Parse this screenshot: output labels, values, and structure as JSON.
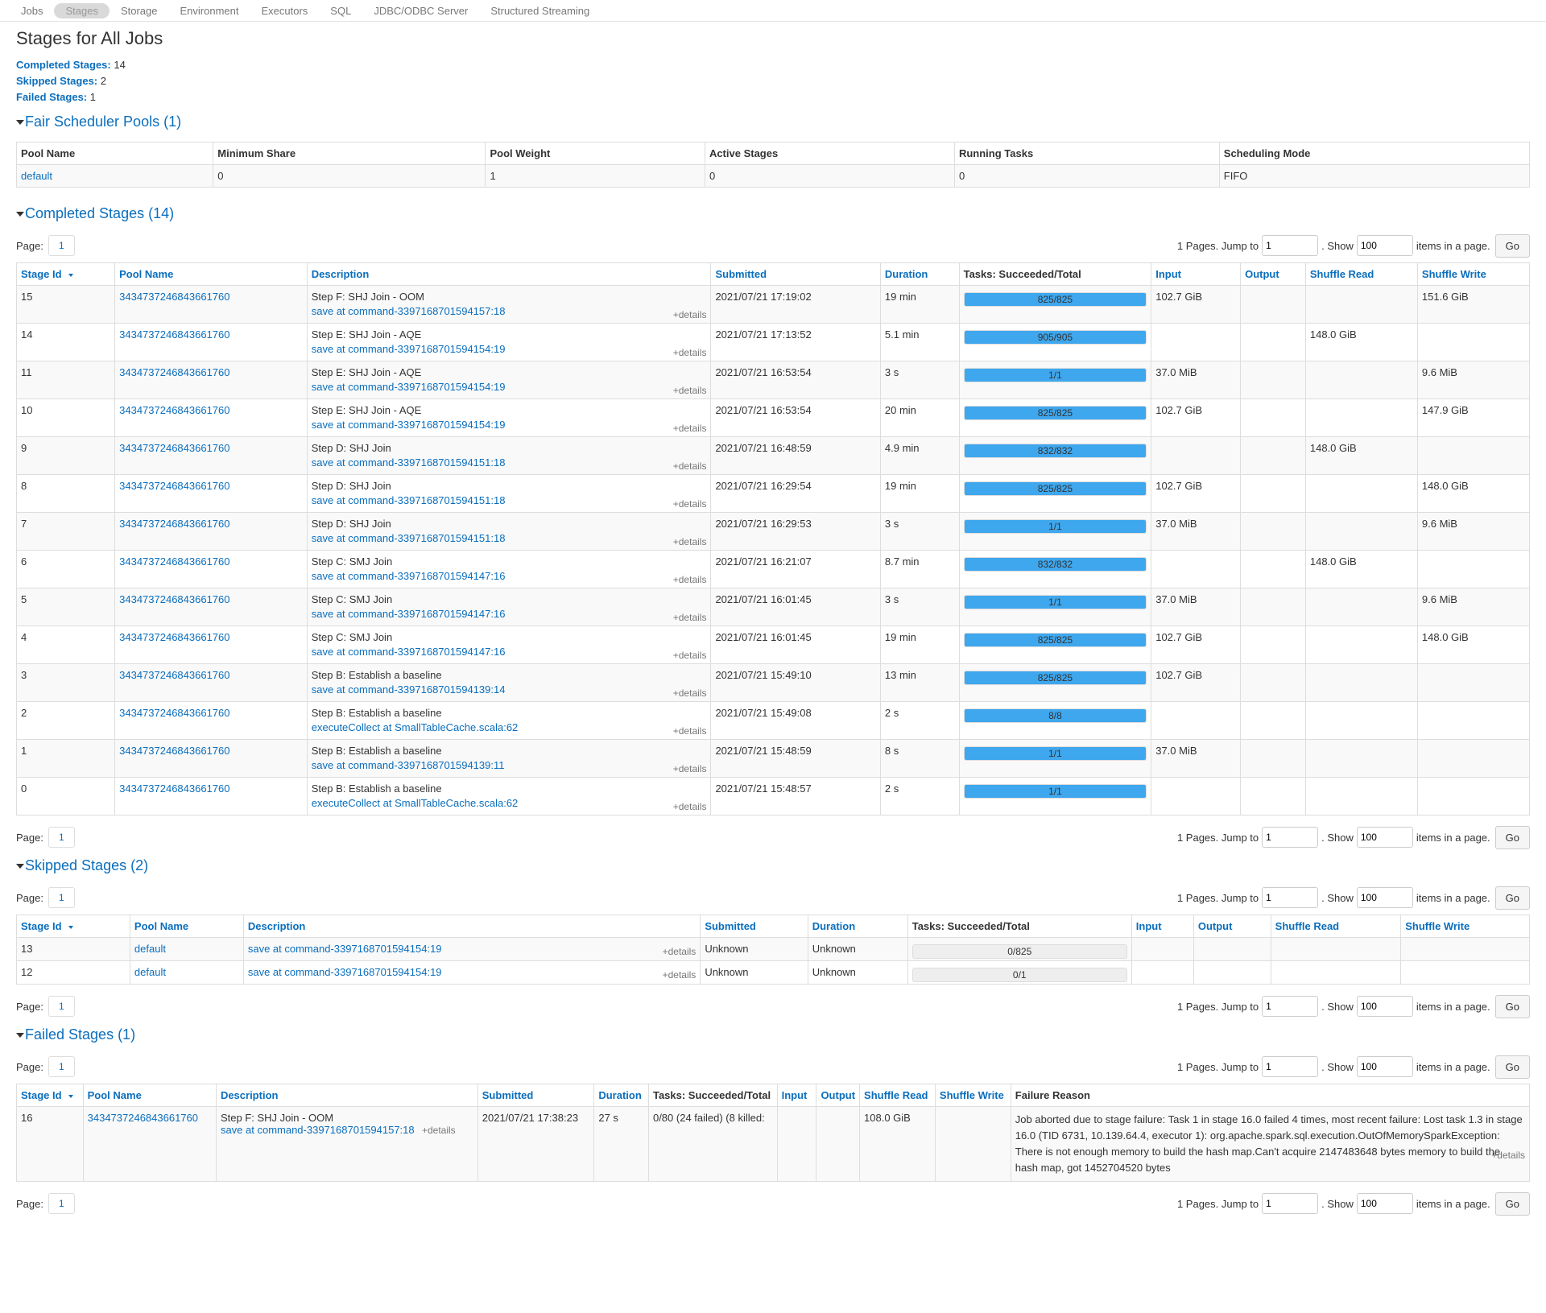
{
  "nav": {
    "tabs": [
      "Jobs",
      "Stages",
      "Storage",
      "Environment",
      "Executors",
      "SQL",
      "JDBC/ODBC Server",
      "Structured Streaming"
    ],
    "active": "Stages"
  },
  "page": {
    "title": "Stages for All Jobs",
    "summary": [
      {
        "label": "Completed Stages:",
        "value": "14"
      },
      {
        "label": "Skipped Stages:",
        "value": "2"
      },
      {
        "label": "Failed Stages:",
        "value": "1"
      }
    ]
  },
  "pools": {
    "header": "Fair Scheduler Pools (1)",
    "columns": [
      "Pool Name",
      "Minimum Share",
      "Pool Weight",
      "Active Stages",
      "Running Tasks",
      "Scheduling Mode"
    ],
    "rows": [
      [
        "default",
        "0",
        "1",
        "0",
        "0",
        "FIFO"
      ]
    ]
  },
  "pager": {
    "page_label": "Page:",
    "page": "1",
    "pages_text": "1 Pages. Jump to",
    "jump_value": "1",
    "show_label": ". Show",
    "show_value": "100",
    "items_label": "items in a page.",
    "go": "Go"
  },
  "details_label": "+details",
  "completed": {
    "header": "Completed Stages (14)",
    "columns": [
      "Stage Id",
      "Pool Name",
      "Description",
      "Submitted",
      "Duration",
      "Tasks: Succeeded/Total",
      "Input",
      "Output",
      "Shuffle Read",
      "Shuffle Write"
    ],
    "rows": [
      {
        "id": "15",
        "pool": "3434737246843661760",
        "desc": "Step F: SHJ Join - OOM",
        "link": "save at command-3397168701594157:18",
        "submitted": "2021/07/21 17:19:02",
        "duration": "19 min",
        "tasks": "825/825",
        "progress": 1,
        "input": "102.7 GiB",
        "output": "",
        "sread": "",
        "swrite": "151.6 GiB"
      },
      {
        "id": "14",
        "pool": "3434737246843661760",
        "desc": "Step E: SHJ Join - AQE",
        "link": "save at command-3397168701594154:19",
        "submitted": "2021/07/21 17:13:52",
        "duration": "5.1 min",
        "tasks": "905/905",
        "progress": 1,
        "input": "",
        "output": "",
        "sread": "148.0 GiB",
        "swrite": ""
      },
      {
        "id": "11",
        "pool": "3434737246843661760",
        "desc": "Step E: SHJ Join - AQE",
        "link": "save at command-3397168701594154:19",
        "submitted": "2021/07/21 16:53:54",
        "duration": "3 s",
        "tasks": "1/1",
        "progress": 1,
        "input": "37.0 MiB",
        "output": "",
        "sread": "",
        "swrite": "9.6 MiB"
      },
      {
        "id": "10",
        "pool": "3434737246843661760",
        "desc": "Step E: SHJ Join - AQE",
        "link": "save at command-3397168701594154:19",
        "submitted": "2021/07/21 16:53:54",
        "duration": "20 min",
        "tasks": "825/825",
        "progress": 1,
        "input": "102.7 GiB",
        "output": "",
        "sread": "",
        "swrite": "147.9 GiB"
      },
      {
        "id": "9",
        "pool": "3434737246843661760",
        "desc": "Step D: SHJ Join",
        "link": "save at command-3397168701594151:18",
        "submitted": "2021/07/21 16:48:59",
        "duration": "4.9 min",
        "tasks": "832/832",
        "progress": 1,
        "input": "",
        "output": "",
        "sread": "148.0 GiB",
        "swrite": ""
      },
      {
        "id": "8",
        "pool": "3434737246843661760",
        "desc": "Step D: SHJ Join",
        "link": "save at command-3397168701594151:18",
        "submitted": "2021/07/21 16:29:54",
        "duration": "19 min",
        "tasks": "825/825",
        "progress": 1,
        "input": "102.7 GiB",
        "output": "",
        "sread": "",
        "swrite": "148.0 GiB"
      },
      {
        "id": "7",
        "pool": "3434737246843661760",
        "desc": "Step D: SHJ Join",
        "link": "save at command-3397168701594151:18",
        "submitted": "2021/07/21 16:29:53",
        "duration": "3 s",
        "tasks": "1/1",
        "progress": 1,
        "input": "37.0 MiB",
        "output": "",
        "sread": "",
        "swrite": "9.6 MiB"
      },
      {
        "id": "6",
        "pool": "3434737246843661760",
        "desc": "Step C: SMJ Join",
        "link": "save at command-3397168701594147:16",
        "submitted": "2021/07/21 16:21:07",
        "duration": "8.7 min",
        "tasks": "832/832",
        "progress": 1,
        "input": "",
        "output": "",
        "sread": "148.0 GiB",
        "swrite": ""
      },
      {
        "id": "5",
        "pool": "3434737246843661760",
        "desc": "Step C: SMJ Join",
        "link": "save at command-3397168701594147:16",
        "submitted": "2021/07/21 16:01:45",
        "duration": "3 s",
        "tasks": "1/1",
        "progress": 1,
        "input": "37.0 MiB",
        "output": "",
        "sread": "",
        "swrite": "9.6 MiB"
      },
      {
        "id": "4",
        "pool": "3434737246843661760",
        "desc": "Step C: SMJ Join",
        "link": "save at command-3397168701594147:16",
        "submitted": "2021/07/21 16:01:45",
        "duration": "19 min",
        "tasks": "825/825",
        "progress": 1,
        "input": "102.7 GiB",
        "output": "",
        "sread": "",
        "swrite": "148.0 GiB"
      },
      {
        "id": "3",
        "pool": "3434737246843661760",
        "desc": "Step B: Establish a baseline",
        "link": "save at command-3397168701594139:14",
        "submitted": "2021/07/21 15:49:10",
        "duration": "13 min",
        "tasks": "825/825",
        "progress": 1,
        "input": "102.7 GiB",
        "output": "",
        "sread": "",
        "swrite": ""
      },
      {
        "id": "2",
        "pool": "3434737246843661760",
        "desc": "Step B: Establish a baseline",
        "link": "executeCollect at SmallTableCache.scala:62",
        "submitted": "2021/07/21 15:49:08",
        "duration": "2 s",
        "tasks": "8/8",
        "progress": 1,
        "input": "",
        "output": "",
        "sread": "",
        "swrite": ""
      },
      {
        "id": "1",
        "pool": "3434737246843661760",
        "desc": "Step B: Establish a baseline",
        "link": "save at command-3397168701594139:11",
        "submitted": "2021/07/21 15:48:59",
        "duration": "8 s",
        "tasks": "1/1",
        "progress": 1,
        "input": "37.0 MiB",
        "output": "",
        "sread": "",
        "swrite": ""
      },
      {
        "id": "0",
        "pool": "3434737246843661760",
        "desc": "Step B: Establish a baseline",
        "link": "executeCollect at SmallTableCache.scala:62",
        "submitted": "2021/07/21 15:48:57",
        "duration": "2 s",
        "tasks": "1/1",
        "progress": 1,
        "input": "",
        "output": "",
        "sread": "",
        "swrite": ""
      }
    ]
  },
  "skipped": {
    "header": "Skipped Stages (2)",
    "columns": [
      "Stage Id",
      "Pool Name",
      "Description",
      "Submitted",
      "Duration",
      "Tasks: Succeeded/Total",
      "Input",
      "Output",
      "Shuffle Read",
      "Shuffle Write"
    ],
    "rows": [
      {
        "id": "13",
        "pool": "default",
        "link": "save at command-3397168701594154:19",
        "submitted": "Unknown",
        "duration": "Unknown",
        "tasks": "0/825",
        "progress": 0
      },
      {
        "id": "12",
        "pool": "default",
        "link": "save at command-3397168701594154:19",
        "submitted": "Unknown",
        "duration": "Unknown",
        "tasks": "0/1",
        "progress": 0
      }
    ]
  },
  "failed": {
    "header": "Failed Stages (1)",
    "columns": [
      "Stage Id",
      "Pool Name",
      "Description",
      "Submitted",
      "Duration",
      "Tasks: Succeeded/Total",
      "Input",
      "Output",
      "Shuffle Read",
      "Shuffle Write",
      "Failure Reason"
    ],
    "rows": [
      {
        "id": "16",
        "pool": "3434737246843661760",
        "desc": "Step F: SHJ Join - OOM",
        "link": "save at command-3397168701594157:18",
        "submitted": "2021/07/21 17:38:23",
        "duration": "27 s",
        "tasks": "0/80 (24 failed) (8 killed:",
        "input": "",
        "output": "",
        "sread": "108.0 GiB",
        "swrite": "",
        "reason": "Job aborted due to stage failure: Task 1 in stage 16.0 failed 4 times, most recent failure: Lost task 1.3 in stage 16.0 (TID 6731, 10.139.64.4, executor 1): org.apache.spark.sql.execution.OutOfMemorySparkException: There is not enough memory to build the hash map.Can't acquire 2147483648 bytes memory to build the hash map, got 1452704520 bytes"
      }
    ]
  },
  "colors": {
    "link": "#0a6ebd",
    "progress": "#3ea7ee"
  }
}
